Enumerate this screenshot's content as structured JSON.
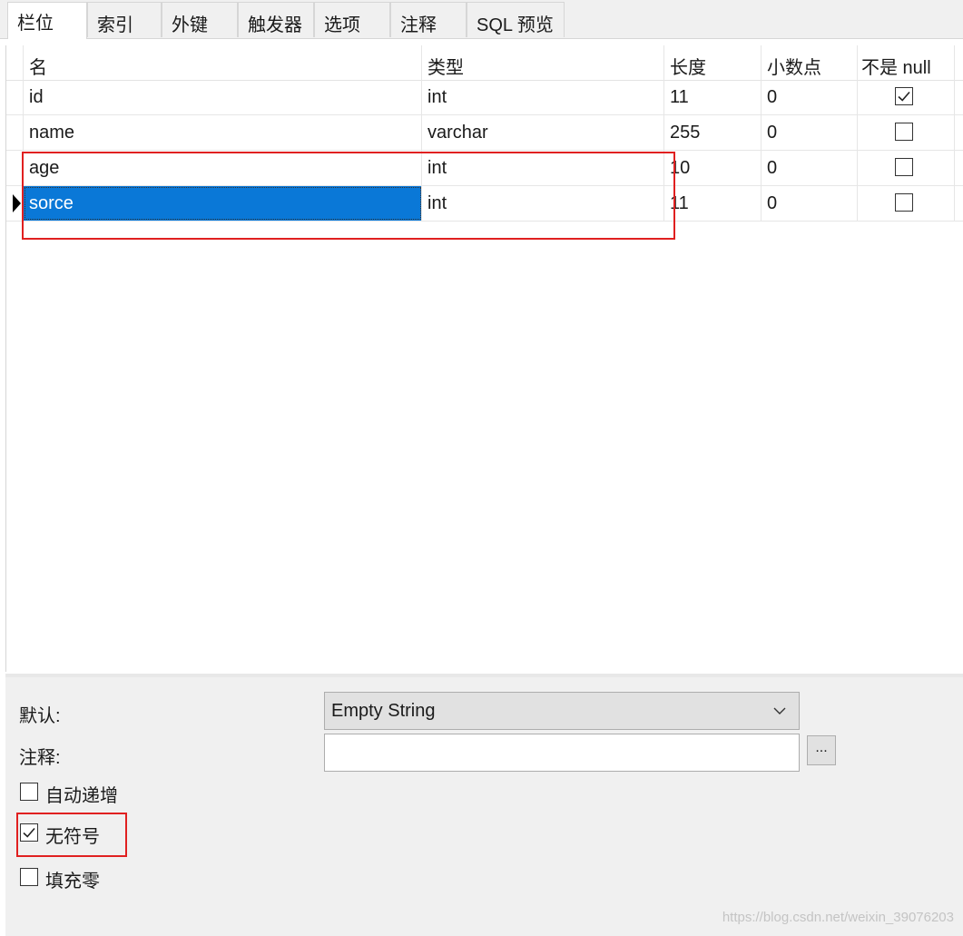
{
  "tabs": [
    {
      "label": "栏位",
      "active": true
    },
    {
      "label": "索引",
      "active": false
    },
    {
      "label": "外键",
      "active": false
    },
    {
      "label": "触发器",
      "active": false
    },
    {
      "label": "选项",
      "active": false
    },
    {
      "label": "注释",
      "active": false
    },
    {
      "label": "SQL 预览",
      "active": false
    }
  ],
  "grid": {
    "columns": [
      "名",
      "类型",
      "长度",
      "小数点",
      "不是 null"
    ],
    "rows": [
      {
        "name": "id",
        "type": "int",
        "length": "11",
        "decimals": "0",
        "not_null": true,
        "current": false,
        "selected": false
      },
      {
        "name": "name",
        "type": "varchar",
        "length": "255",
        "decimals": "0",
        "not_null": false,
        "current": false,
        "selected": false
      },
      {
        "name": "age",
        "type": "int",
        "length": "10",
        "decimals": "0",
        "not_null": false,
        "current": false,
        "selected": false
      },
      {
        "name": "sorce",
        "type": "int",
        "length": "11",
        "decimals": "0",
        "not_null": false,
        "current": true,
        "selected": true
      }
    ]
  },
  "properties": {
    "default_label": "默认:",
    "default_value": "Empty String",
    "comment_label": "注释:",
    "comment_value": "",
    "ellipsis_label": "...",
    "auto_increment_label": "自动递增",
    "auto_increment_checked": false,
    "unsigned_label": "无符号",
    "unsigned_checked": true,
    "zerofill_label": "填充零",
    "zerofill_checked": false
  },
  "watermark": "https://blog.csdn.net/weixin_39076203",
  "colors": {
    "selection": "#0a78d7",
    "highlight": "#e02020",
    "panel": "#f0f0f0"
  }
}
